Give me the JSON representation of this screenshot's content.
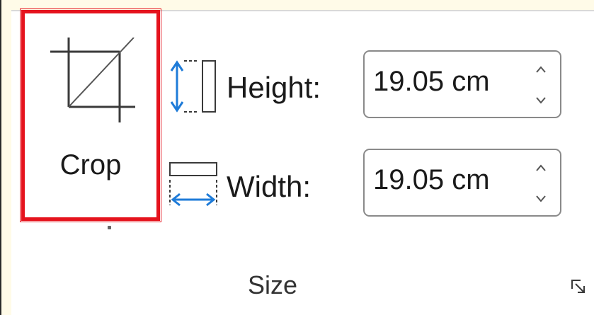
{
  "crop": {
    "label": "Crop",
    "icon": "crop-icon",
    "highlight_color": "#e5131d"
  },
  "height": {
    "label": "Height:",
    "value": "19.05 cm",
    "icon": "shape-height-icon"
  },
  "width": {
    "label": "Width:",
    "value": "19.05 cm",
    "icon": "shape-width-icon"
  },
  "group": {
    "label": "Size",
    "launcher_icon": "dialog-launcher-icon"
  },
  "colors": {
    "accent_blue": "#1e7bd8"
  }
}
